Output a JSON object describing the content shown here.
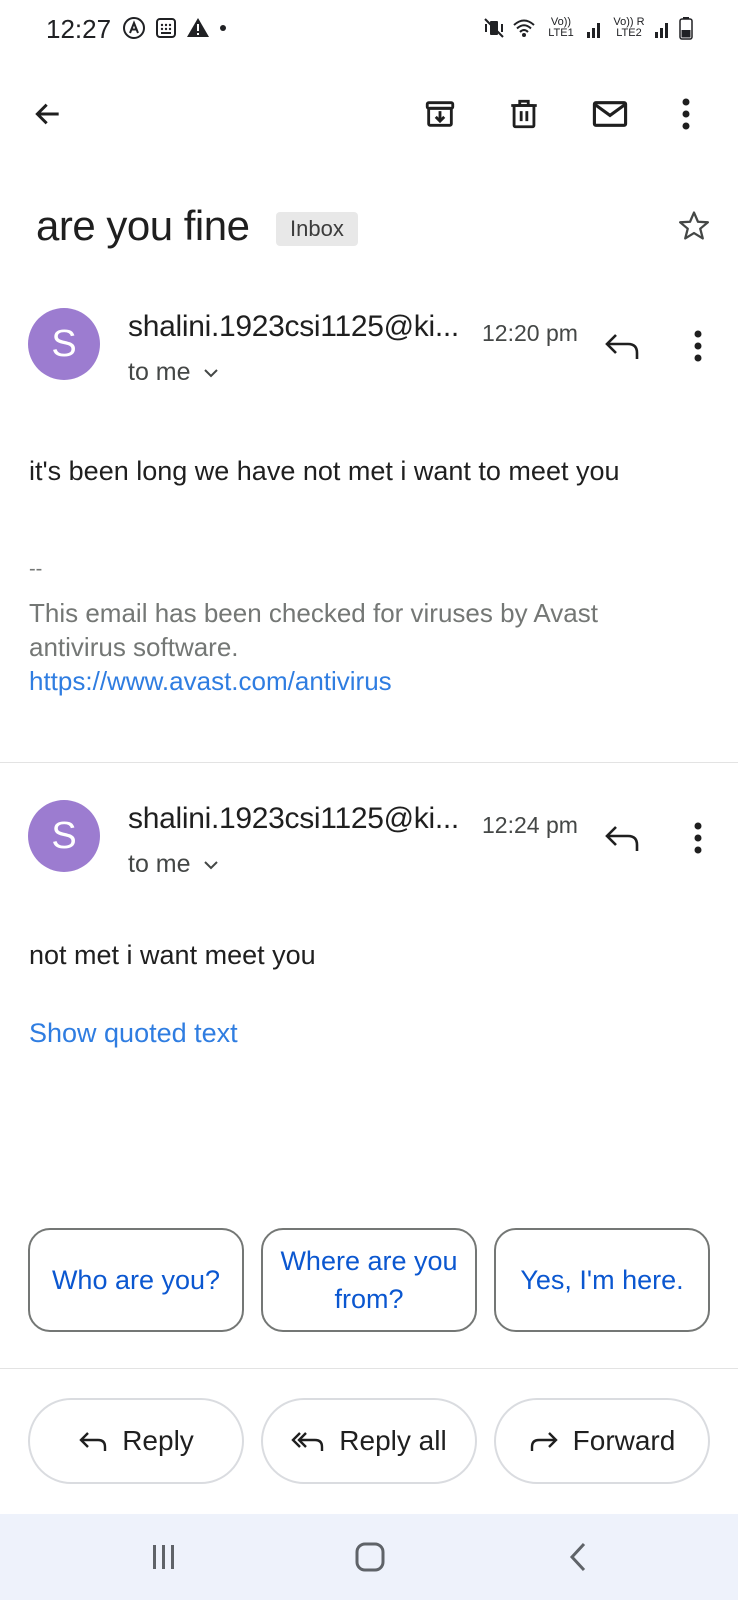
{
  "status_bar": {
    "time": "12:27",
    "sim1_label": "Vo)) LTE1",
    "sim2_label": "Vo)) R LTE2"
  },
  "toolbar": {
    "back": "back-arrow-icon",
    "archive": "archive-icon",
    "delete": "delete-icon",
    "mark_unread": "mail-icon",
    "more": "more-vert-icon"
  },
  "subject": {
    "title": "are you fine",
    "label": "Inbox"
  },
  "messages": [
    {
      "avatar_letter": "S",
      "sender": "shalini.1923csi1125@ki...",
      "time": "12:20 pm",
      "recipient": "to me",
      "body": "it's been long we have not met i want to meet you",
      "signature_separator": "--",
      "signature_line1": "This email has been checked for viruses by Avast",
      "signature_line2": "antivirus software.",
      "signature_link": "https://www.avast.com/antivirus"
    },
    {
      "avatar_letter": "S",
      "sender": "shalini.1923csi1125@ki...",
      "time": "12:24 pm",
      "recipient": "to me",
      "body": "not met i want meet you",
      "show_quoted": "Show quoted text"
    }
  ],
  "smart_replies": [
    {
      "label": "Who are you?"
    },
    {
      "label_line1": "Where are you",
      "label_line2": "from?"
    },
    {
      "label": "Yes, I'm here."
    }
  ],
  "actions": {
    "reply": "Reply",
    "reply_all": "Reply all",
    "forward": "Forward"
  },
  "colors": {
    "avatar": "#9c7cd0",
    "link": "#2f7de1",
    "chip_text": "#0b57d0",
    "nav_bar": "#eef2fb"
  }
}
